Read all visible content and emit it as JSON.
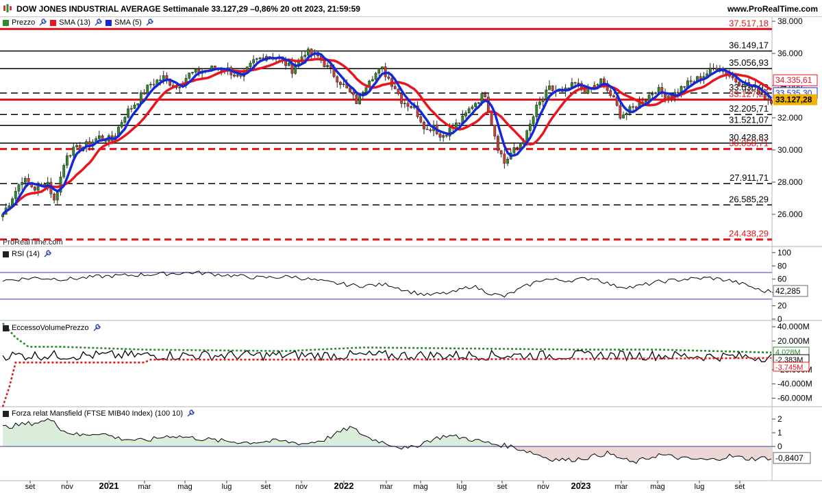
{
  "header": {
    "title": "DOW JONES INDUSTRIAL AVERAGE Settimanale 33.127,29 –0,86% 20 ott 2023, 21:59:59",
    "brand": "www.ProRealTime.com",
    "watermark": "ProRealTime.com"
  },
  "colors": {
    "bull": "#2e8b2e",
    "bear": "#d23c32",
    "sma13": "#e8141e",
    "sma5": "#1528d8",
    "last_price_bg": "#f0b400",
    "mfi_green": "#2a8a2a",
    "mfi_red": "#e01818",
    "mansfield_pos_fill": "#dbeedb",
    "mansfield_neg_fill": "#ecd6d6"
  },
  "panels": {
    "price_legend": [
      {
        "label": "Prezzo",
        "color": "#2e8b2e",
        "icon": "wrench-icon"
      },
      {
        "label": "SMA (13)",
        "color": "#e8141e",
        "icon": "wrench-icon"
      },
      {
        "label": "SMA (5)",
        "color": "#1528d8",
        "icon": "wrench-icon"
      }
    ],
    "rsi_label": "RSI (14)",
    "volume_label": "EccessoVolumePrezzo",
    "mansfield_label": "Forza relat Mansfield (FTSE MIB40 Index) (100 10)"
  },
  "chart_data": [
    {
      "type": "candlestick",
      "title": "DOW JONES INDUSTRIAL AVERAGE Settimanale",
      "period": "weekly",
      "ylim": [
        24000,
        38300
      ],
      "yticks": [
        "26.000",
        "28.000",
        "30.000",
        "32.000",
        "34.000",
        "36.000",
        "38.000"
      ],
      "ytick_values": [
        26000,
        28000,
        30000,
        32000,
        34000,
        36000,
        38000
      ],
      "xticks": [
        "set",
        "nov",
        "2021",
        "mar",
        "mag",
        "lug",
        "set",
        "nov",
        "2022",
        "mar",
        "mag",
        "lug",
        "set",
        "nov",
        "2023",
        "mar",
        "mag",
        "lug",
        "set"
      ],
      "xtick_year_labels": [
        "2021",
        "2022",
        "2023"
      ],
      "close_path": [
        [
          0,
          26000
        ],
        [
          6,
          28200
        ],
        [
          10,
          27600
        ],
        [
          14,
          28000
        ],
        [
          16,
          26800
        ],
        [
          20,
          29800
        ],
        [
          26,
          30300
        ],
        [
          30,
          30800
        ],
        [
          34,
          30600
        ],
        [
          38,
          32200
        ],
        [
          42,
          33100
        ],
        [
          46,
          34100
        ],
        [
          50,
          34500
        ],
        [
          54,
          33900
        ],
        [
          58,
          34700
        ],
        [
          62,
          34900
        ],
        [
          66,
          35100
        ],
        [
          70,
          35000
        ],
        [
          74,
          34400
        ],
        [
          78,
          35500
        ],
        [
          82,
          35900
        ],
        [
          86,
          35700
        ],
        [
          90,
          35000
        ],
        [
          94,
          36100
        ],
        [
          98,
          35800
        ],
        [
          102,
          34900
        ],
        [
          106,
          34000
        ],
        [
          110,
          33000
        ],
        [
          114,
          34500
        ],
        [
          118,
          35000
        ],
        [
          122,
          33900
        ],
        [
          124,
          33100
        ],
        [
          128,
          32600
        ],
        [
          132,
          31200
        ],
        [
          134,
          31600
        ],
        [
          136,
          30800
        ],
        [
          140,
          31400
        ],
        [
          143,
          31900
        ],
        [
          146,
          32800
        ],
        [
          150,
          33500
        ],
        [
          152,
          31700
        ],
        [
          154,
          30200
        ],
        [
          156,
          29200
        ],
        [
          158,
          29800
        ],
        [
          160,
          30100
        ],
        [
          163,
          31000
        ],
        [
          166,
          32600
        ],
        [
          170,
          33800
        ],
        [
          174,
          33500
        ],
        [
          178,
          34100
        ],
        [
          182,
          33600
        ],
        [
          186,
          34300
        ],
        [
          190,
          33100
        ],
        [
          192,
          32200
        ],
        [
          194,
          32300
        ],
        [
          196,
          32600
        ],
        [
          200,
          33200
        ],
        [
          203,
          33800
        ],
        [
          206,
          33400
        ],
        [
          209,
          33500
        ],
        [
          212,
          34000
        ],
        [
          216,
          34400
        ],
        [
          220,
          34900
        ],
        [
          222,
          35200
        ],
        [
          225,
          34800
        ],
        [
          228,
          34300
        ],
        [
          232,
          34000
        ],
        [
          236,
          33500
        ],
        [
          238,
          33127
        ]
      ],
      "series": [
        {
          "name": "Prezzo",
          "kind": "candles"
        },
        {
          "name": "SMA (13)",
          "color": "#e8141e"
        },
        {
          "name": "SMA (5)",
          "color": "#1528d8"
        }
      ],
      "horizontal_levels": [
        {
          "label": "37.517,18",
          "value": 37517,
          "style": "solid",
          "color": "#e8141e"
        },
        {
          "label": "36.149,17",
          "value": 36149,
          "style": "solid",
          "color": "#000000"
        },
        {
          "label": "35.056,93",
          "value": 35057,
          "style": "solid",
          "color": "#000000"
        },
        {
          "label": "33.536,93",
          "value": 33536,
          "style": "dashed",
          "color": "#000000"
        },
        {
          "label": "33.127,28",
          "value": 33127,
          "style": "solid",
          "color": "#e8141e"
        },
        {
          "label": "32.205,71",
          "value": 32206,
          "style": "dashed",
          "color": "#000000"
        },
        {
          "label": "31.521,07",
          "value": 31521,
          "style": "solid",
          "color": "#000000"
        },
        {
          "label": "30.428,83",
          "value": 30429,
          "style": "solid",
          "color": "#000000"
        },
        {
          "label": "30.058,71",
          "value": 30059,
          "style": "dashed",
          "color": "#e8141e"
        },
        {
          "label": "27.911,71",
          "value": 27912,
          "style": "dashed",
          "color": "#000000"
        },
        {
          "label": "26.585,29",
          "value": 26585,
          "style": "dashed",
          "color": "#000000"
        },
        {
          "label": "24.438,29",
          "value": 24438,
          "style": "dashed",
          "color": "#e8141e"
        }
      ],
      "last_values": [
        {
          "label": "34.335,61",
          "series": "SMA (13)",
          "value": 34336
        },
        {
          "label": "33.535,30",
          "series": "SMA (5)",
          "value": 33535
        },
        {
          "label": "33.127,28",
          "series": "Prezzo",
          "value": 33127
        }
      ]
    },
    {
      "type": "line",
      "title": "RSI (14)",
      "ylim": [
        0,
        105
      ],
      "yticks": [
        "0",
        "20",
        "40",
        "60",
        "80",
        "100"
      ],
      "ytick_values": [
        0,
        20,
        40,
        60,
        80,
        100
      ],
      "bands": [
        30,
        70
      ],
      "last_value": {
        "label": "42,285",
        "value": 42.285
      },
      "path": [
        [
          0,
          58
        ],
        [
          10,
          62
        ],
        [
          20,
          60
        ],
        [
          30,
          64
        ],
        [
          40,
          66
        ],
        [
          50,
          68
        ],
        [
          60,
          70
        ],
        [
          70,
          66
        ],
        [
          80,
          62
        ],
        [
          90,
          64
        ],
        [
          100,
          56
        ],
        [
          110,
          50
        ],
        [
          120,
          52
        ],
        [
          126,
          42
        ],
        [
          132,
          36
        ],
        [
          140,
          40
        ],
        [
          146,
          50
        ],
        [
          152,
          38
        ],
        [
          156,
          34
        ],
        [
          162,
          48
        ],
        [
          168,
          60
        ],
        [
          176,
          58
        ],
        [
          184,
          62
        ],
        [
          190,
          50
        ],
        [
          196,
          48
        ],
        [
          204,
          56
        ],
        [
          212,
          60
        ],
        [
          220,
          62
        ],
        [
          226,
          58
        ],
        [
          232,
          50
        ],
        [
          236,
          42
        ],
        [
          238,
          42
        ]
      ]
    },
    {
      "type": "line",
      "title": "EccessoVolumePrezzo",
      "ylim": [
        -70000000,
        45000000
      ],
      "yticks": [
        "-60.000M",
        "-40.000M",
        "-20.000M",
        "20.000M",
        "40.000M"
      ],
      "ytick_values": [
        -60000000,
        -40000000,
        -20000000,
        20000000,
        40000000
      ],
      "last_values": [
        {
          "label": "4.028M",
          "value": 4028000,
          "color": "#2a8a2a"
        },
        {
          "label": "-2.383M",
          "value": -2383000,
          "color": "#000000"
        },
        {
          "label": "-3.745M",
          "value": -3745000,
          "color": "#e01818"
        }
      ],
      "series": [
        {
          "name": "upper",
          "color": "#2a8a2a",
          "path": [
            [
              0,
              45000000
            ],
            [
              4,
              25000000
            ],
            [
              8,
              12000000
            ],
            [
              18,
              12000000
            ],
            [
              44,
              8000000
            ],
            [
              88,
              6000000
            ],
            [
              112,
              11000000
            ],
            [
              180,
              8000000
            ],
            [
              204,
              8000000
            ],
            [
              238,
              4028000
            ]
          ]
        },
        {
          "name": "value",
          "color": "#000000",
          "path": [
            [
              0,
              0
            ],
            [
              40,
              0
            ],
            [
              80,
              0
            ],
            [
              120,
              0
            ],
            [
              160,
              0
            ],
            [
              200,
              0
            ],
            [
              238,
              -2383000
            ]
          ]
        },
        {
          "name": "lower",
          "color": "#e01818",
          "path": [
            [
              0,
              -72000000
            ],
            [
              2,
              -45000000
            ],
            [
              4,
              -10000000
            ],
            [
              44,
              -10000000
            ],
            [
              46,
              -6000000
            ],
            [
              112,
              -6000000
            ],
            [
              180,
              -5000000
            ],
            [
              238,
              -3745000
            ]
          ]
        }
      ]
    },
    {
      "type": "area",
      "title": "Forza relat Mansfield (FTSE MIB40 Index) (100 10)",
      "ylim": [
        -2.4,
        2.7
      ],
      "yticks": [
        "0",
        "1",
        "2"
      ],
      "ytick_values": [
        0,
        1,
        2
      ],
      "last_value": {
        "label": "-0,8407",
        "value": -0.8407
      },
      "path": [
        [
          0,
          1.4
        ],
        [
          6,
          1.6
        ],
        [
          12,
          1.8
        ],
        [
          16,
          2.0
        ],
        [
          18,
          1.2
        ],
        [
          24,
          0.8
        ],
        [
          30,
          1.0
        ],
        [
          36,
          0.6
        ],
        [
          44,
          0.4
        ],
        [
          52,
          0.8
        ],
        [
          60,
          0.6
        ],
        [
          68,
          0.4
        ],
        [
          76,
          0.3
        ],
        [
          86,
          0.4
        ],
        [
          94,
          0.2
        ],
        [
          100,
          0.5
        ],
        [
          108,
          1.4
        ],
        [
          114,
          0.6
        ],
        [
          120,
          0.2
        ],
        [
          126,
          -0.2
        ],
        [
          132,
          0.4
        ],
        [
          138,
          0.8
        ],
        [
          144,
          0.6
        ],
        [
          152,
          0.2
        ],
        [
          158,
          0.0
        ],
        [
          164,
          -0.4
        ],
        [
          170,
          -0.9
        ],
        [
          176,
          -1.0
        ],
        [
          182,
          -0.8
        ],
        [
          188,
          -0.5
        ],
        [
          196,
          -1.2
        ],
        [
          204,
          -0.6
        ],
        [
          212,
          -0.9
        ],
        [
          220,
          -1.0
        ],
        [
          226,
          -0.7
        ],
        [
          232,
          -0.9
        ],
        [
          238,
          -0.84
        ]
      ]
    }
  ]
}
